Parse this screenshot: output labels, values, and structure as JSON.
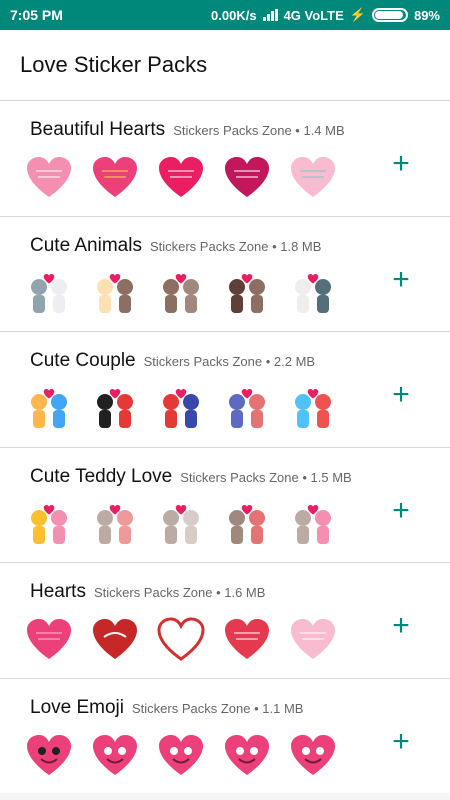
{
  "status": {
    "time": "7:05 PM",
    "speed": "0.00K/s",
    "network": "4G VoLTE",
    "battery": "89%",
    "battery_level": 0.89
  },
  "header": {
    "title": "Love Sticker Packs"
  },
  "packs": [
    {
      "name": "Beautiful Hearts",
      "publisher": "Stickers Packs Zone",
      "size": "1.4 MB",
      "stickers": [
        "birds-heart-sticker",
        "flower-heart-sticker",
        "striped-heart-sticker",
        "diamond-heart-sticker",
        "leaf-heart-sticker"
      ]
    },
    {
      "name": "Cute Animals",
      "publisher": "Stickers Packs Zone",
      "size": "1.8 MB",
      "stickers": [
        "cat-couple-sticker",
        "dog-couple-sticker",
        "bear-couple-sticker",
        "squirrel-couple-sticker",
        "kitten-couple-sticker"
      ]
    },
    {
      "name": "Cute Couple",
      "publisher": "Stickers Packs Zone",
      "size": "2.2 MB",
      "stickers": [
        "couple-walking-sticker",
        "couple-hug-sticker",
        "couple-kiss-sticker",
        "couple-dinner-sticker",
        "couple-bench-sticker"
      ]
    },
    {
      "name": "Cute Teddy Love",
      "publisher": "Stickers Packs Zone",
      "size": "1.5 MB",
      "stickers": [
        "teddy-love-letters-sticker",
        "teddy-heart-sticker",
        "teddy-couple-sticker",
        "teddy-balloon-sticker",
        "teddy-flowers-sticker"
      ]
    },
    {
      "name": "Hearts",
      "publisher": "Stickers Packs Zone",
      "size": "1.6 MB",
      "stickers": [
        "pink-heart-sticker",
        "love-heart-sticker",
        "outline-heart-sticker",
        "sketch-heart-sticker",
        "dotted-heart-sticker"
      ]
    },
    {
      "name": "Love Emoji",
      "publisher": "Stickers Packs Zone",
      "size": "1.1 MB",
      "stickers": [
        "cool-heart-emoji",
        "smile-heart-emoji",
        "grin-heart-emoji",
        "surprised-heart-emoji",
        "wink-heart-emoji"
      ]
    }
  ],
  "add_label": "+",
  "colors": {
    "accent": "#00897b",
    "heart_pink": "#e91e63",
    "heart_red": "#d32f2f"
  }
}
